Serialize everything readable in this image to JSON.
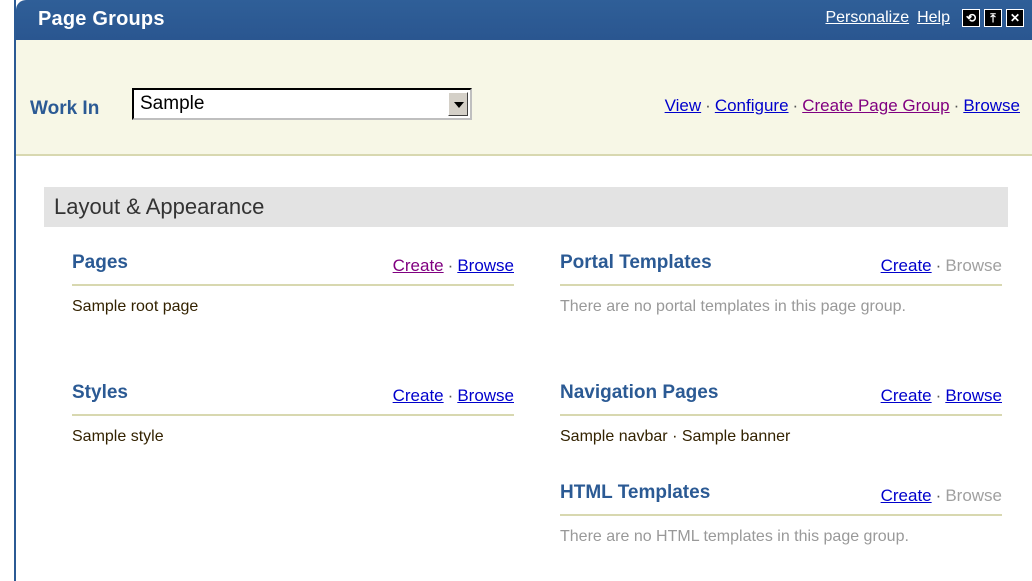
{
  "title": "Page Groups",
  "title_links": {
    "personalize": "Personalize",
    "help": "Help"
  },
  "title_controls": {
    "refresh": "⟲",
    "collapse": "⤒",
    "close": "✕"
  },
  "work_in": {
    "label": "Work In",
    "value": "Sample"
  },
  "work_links": {
    "view": "View",
    "configure": "Configure",
    "create_page_group": "Create Page Group",
    "browse": "Browse"
  },
  "section": {
    "title": "Layout & Appearance"
  },
  "blocks": {
    "pages": {
      "name": "Pages",
      "create": "Create",
      "browse": "Browse",
      "content": "Sample root page"
    },
    "styles": {
      "name": "Styles",
      "create": "Create",
      "browse": "Browse",
      "content": "Sample style"
    },
    "portal_templates": {
      "name": "Portal Templates",
      "create": "Create",
      "browse": "Browse",
      "content": "There are no portal templates in this page group."
    },
    "navigation_pages": {
      "name": "Navigation Pages",
      "create": "Create",
      "browse": "Browse",
      "content": "Sample navbar · Sample banner"
    },
    "html_templates": {
      "name": "HTML Templates",
      "create": "Create",
      "browse": "Browse",
      "content": "There are no HTML templates in this page group."
    }
  },
  "separator": "·",
  "colors": {
    "titlebar": "#2b5a94",
    "workbar": "#f7f7e6",
    "link": "#0000cc",
    "visited_link": "#800080",
    "disabled": "#a0a0a0"
  }
}
